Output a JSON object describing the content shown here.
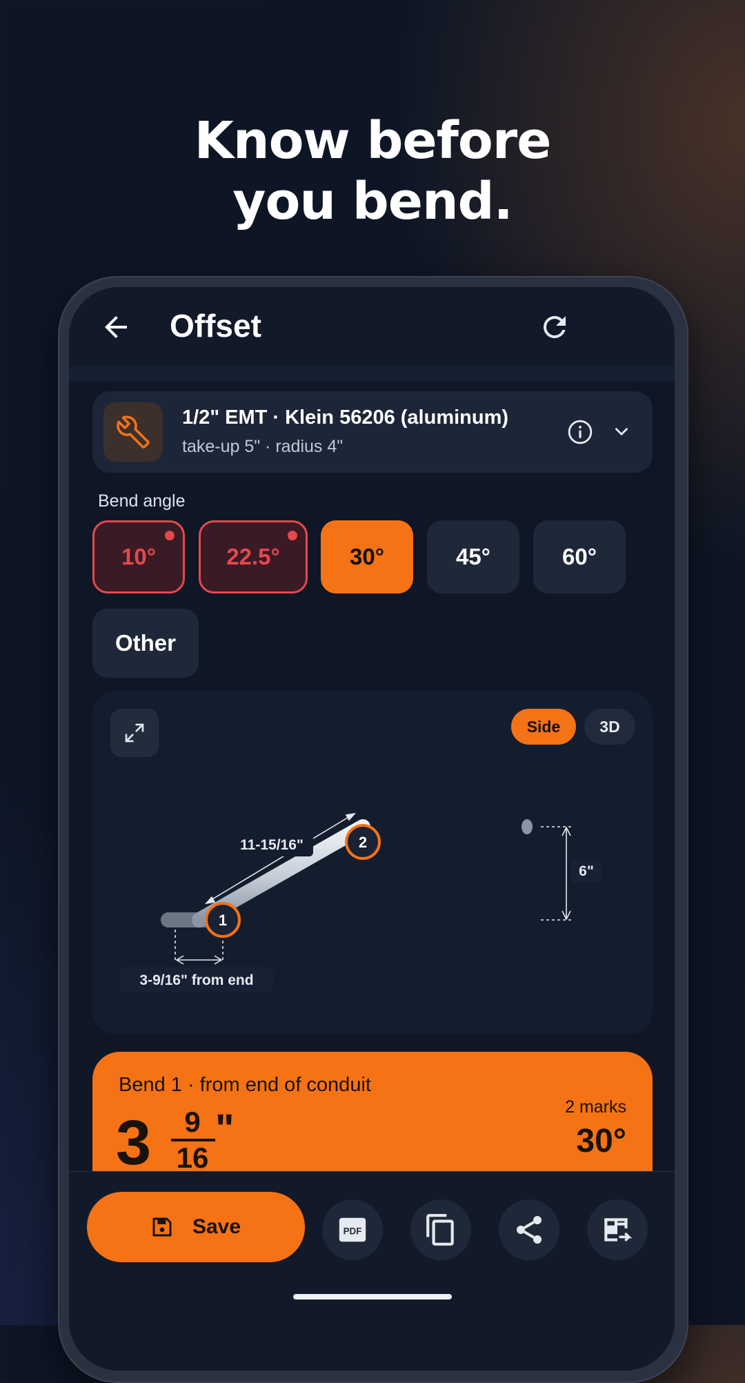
{
  "headline": {
    "line1": "Know before",
    "line2": "you bend."
  },
  "header": {
    "title": "Offset"
  },
  "conduit": {
    "title": "1/2\" EMT · Klein 56206 (aluminum)",
    "subtitle": "take-up 5\" · radius 4\""
  },
  "bend_angle": {
    "label": "Bend angle",
    "options": [
      {
        "label": "10°",
        "state": "warning"
      },
      {
        "label": "22.5°",
        "state": "warning"
      },
      {
        "label": "30°",
        "state": "selected"
      },
      {
        "label": "45°",
        "state": "normal"
      },
      {
        "label": "60°",
        "state": "normal"
      }
    ],
    "other_label": "Other"
  },
  "diagram": {
    "view_side": "Side",
    "view_3d": "3D",
    "active_view": "Side",
    "bend1_marker": "1",
    "bend2_marker": "2",
    "between_bends": "11-15/16\"",
    "offset_depth": "6\"",
    "from_end": "3-9/16\" from end"
  },
  "result": {
    "label": "Bend 1 · from end of conduit",
    "whole": "3",
    "numerator": "9",
    "denominator": "16",
    "unit": "\"",
    "marks": "2 marks",
    "angle": "30°"
  },
  "actions": {
    "save_label": "Save",
    "pdf_label": "PDF",
    "icons": [
      "pdf-icon",
      "copy-icon",
      "share-icon",
      "table-export-icon"
    ]
  },
  "colors": {
    "accent": "#f57215",
    "warning": "#e5484d",
    "background": "#0e1626",
    "card": "#1d2638"
  }
}
